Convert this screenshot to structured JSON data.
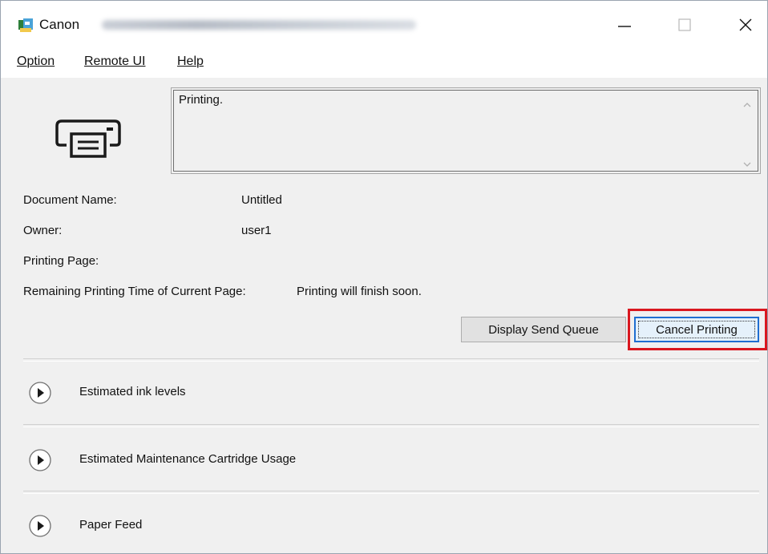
{
  "window": {
    "title": "Canon"
  },
  "menu": {
    "items": [
      {
        "label": "Option"
      },
      {
        "label": "Remote UI"
      },
      {
        "label": "Help"
      }
    ]
  },
  "status": {
    "message": "Printing."
  },
  "info": {
    "document_name_label": "Document Name:",
    "document_name_value": "Untitled",
    "owner_label": "Owner:",
    "owner_value": "user1",
    "printing_page_label": "Printing Page:",
    "remaining_label": "Remaining Printing Time of Current Page:",
    "remaining_value": "Printing will finish soon."
  },
  "buttons": {
    "display_send_queue": "Display Send Queue",
    "cancel_printing": "Cancel Printing"
  },
  "sections": [
    {
      "label": "Estimated ink levels"
    },
    {
      "label": "Estimated Maintenance Cartridge Usage"
    },
    {
      "label": "Paper Feed"
    }
  ],
  "colors": {
    "highlight": "#d9171f",
    "focus_border": "#1f6ed1"
  }
}
